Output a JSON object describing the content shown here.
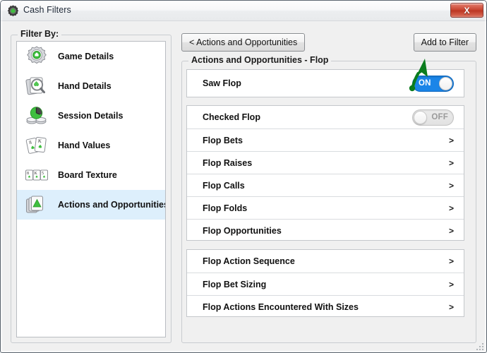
{
  "window": {
    "title": "Cash Filters",
    "app_icon": "gear-spade-icon",
    "close_label": "X"
  },
  "sidebar": {
    "group_label": "Filter By:",
    "items": [
      {
        "label": "Game Details",
        "icon": "gear-spade-icon",
        "selected": false
      },
      {
        "label": "Hand Details",
        "icon": "cards-magnifier-icon",
        "selected": false
      },
      {
        "label": "Session Details",
        "icon": "chips-clock-icon",
        "selected": false
      },
      {
        "label": "Hand Values",
        "icon": "two-cards-icon",
        "selected": false
      },
      {
        "label": "Board Texture",
        "icon": "three-cards-icon",
        "selected": false
      },
      {
        "label": "Actions and Opportunities",
        "icon": "card-stack-arrow-icon",
        "selected": true
      }
    ]
  },
  "toolbar": {
    "back_label": "< Actions and Opportunities",
    "add_to_filter_label": "Add to Filter"
  },
  "main": {
    "group_label": "Actions and Opportunities - Flop",
    "panels": [
      {
        "name": "saw-flop",
        "rows": [
          {
            "label": "Saw Flop",
            "control": "toggle",
            "state": "ON"
          }
        ]
      },
      {
        "name": "flop-actions",
        "rows": [
          {
            "label": "Checked Flop",
            "control": "toggle",
            "state": "OFF"
          },
          {
            "label": "Flop Bets",
            "control": "chevron",
            "state": ">"
          },
          {
            "label": "Flop Raises",
            "control": "chevron",
            "state": ">"
          },
          {
            "label": "Flop Calls",
            "control": "chevron",
            "state": ">"
          },
          {
            "label": "Flop Folds",
            "control": "chevron",
            "state": ">"
          },
          {
            "label": "Flop Opportunities",
            "control": "chevron",
            "state": ">"
          }
        ]
      },
      {
        "name": "flop-sequence",
        "rows": [
          {
            "label": "Flop Action Sequence",
            "control": "chevron",
            "state": ">"
          },
          {
            "label": "Flop Bet Sizing",
            "control": "chevron",
            "state": ">"
          },
          {
            "label": "Flop Actions Encountered With Sizes",
            "control": "chevron",
            "state": ">"
          }
        ]
      }
    ]
  },
  "annotation": {
    "type": "arrow",
    "color": "#0b7c1e",
    "points_to": "Add to Filter"
  },
  "colors": {
    "accent_toggle_on": "#1a85e8",
    "selection": "#ddeffc",
    "window_bg": "#f0f0f0",
    "close_button": "#c6402c",
    "annotation_green": "#0b7c1e"
  }
}
